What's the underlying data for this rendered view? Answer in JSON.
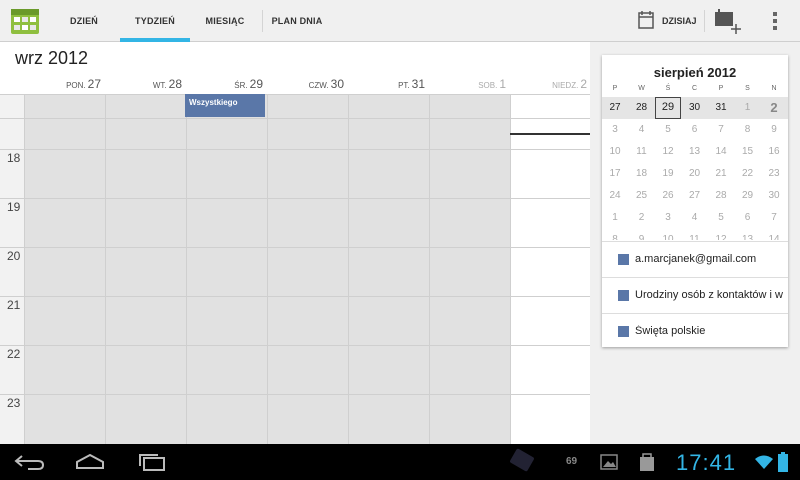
{
  "action_bar": {
    "tabs": [
      {
        "label": "DZIEŃ"
      },
      {
        "label": "TYDZIEŃ"
      },
      {
        "label": "MIESIĄC"
      },
      {
        "label": "PLAN DNIA"
      }
    ],
    "active_tab": "TYDZIEŃ",
    "today_label": "DZISIAJ",
    "accent_color": "#33b5e5"
  },
  "week_view": {
    "month_title": "wrz 2012",
    "days": [
      {
        "dow": "PON.",
        "num": "27"
      },
      {
        "dow": "WT.",
        "num": "28"
      },
      {
        "dow": "ŚR.",
        "num": "29"
      },
      {
        "dow": "CZW.",
        "num": "30"
      },
      {
        "dow": "PT.",
        "num": "31"
      },
      {
        "dow": "SOB.",
        "num": "1"
      },
      {
        "dow": "NIEDZ.",
        "num": "2"
      }
    ],
    "hours": [
      "18",
      "19",
      "20",
      "21",
      "22",
      "23"
    ],
    "all_day_event": {
      "title": "Wszystkiego",
      "color": "#5a77a8"
    }
  },
  "mini_calendar": {
    "title": "sierpień 2012",
    "dow": [
      "P",
      "W",
      "Ś",
      "C",
      "P",
      "S",
      "N"
    ],
    "weeks": [
      [
        "27",
        "28",
        "29",
        "30",
        "31",
        "1",
        "2"
      ],
      [
        "3",
        "4",
        "5",
        "6",
        "7",
        "8",
        "9"
      ],
      [
        "10",
        "11",
        "12",
        "13",
        "14",
        "15",
        "16"
      ],
      [
        "17",
        "18",
        "19",
        "20",
        "21",
        "22",
        "23"
      ],
      [
        "24",
        "25",
        "26",
        "27",
        "28",
        "29",
        "30"
      ],
      [
        "1",
        "2",
        "3",
        "4",
        "5",
        "6",
        "7"
      ],
      [
        "8",
        "9",
        "10",
        "11",
        "12",
        "13",
        "14"
      ]
    ],
    "today": "29"
  },
  "calendars": [
    {
      "name": "a.marcjanek@gmail.com",
      "color": "#5a77a8"
    },
    {
      "name": "Urodziny osób z kontaktów i w",
      "color": "#5a77a8"
    },
    {
      "name": "Święta polskie",
      "color": "#5a77a8"
    }
  ],
  "system_bar": {
    "notification_count": "69",
    "clock": "17:41"
  }
}
